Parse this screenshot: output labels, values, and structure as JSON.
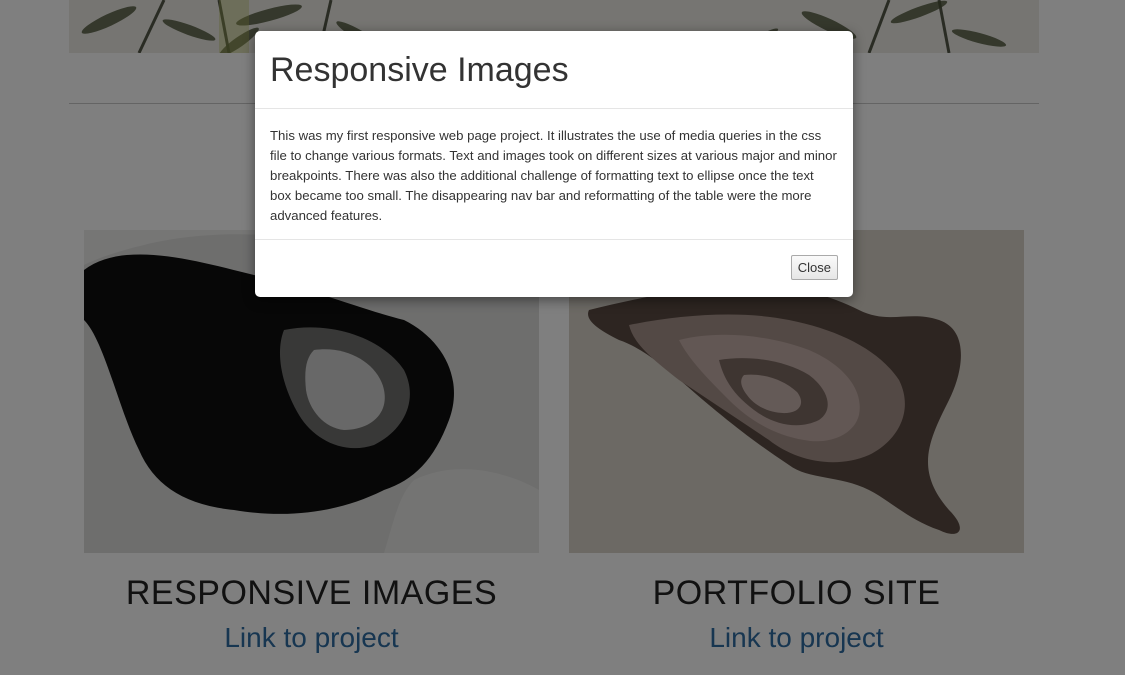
{
  "modal": {
    "title": "Responsive Images",
    "body": "This was my first responsive web page project. It illustrates the use of media queries in the css file to change various formats. Text and images took on different sizes at various major and minor breakpoints. There was also the additional challenge of formatting text to ellipse once the text box became too small. The disappearing nav bar and reformatting of the table were the more advanced features.",
    "close_label": "Close"
  },
  "projects": [
    {
      "title": "RESPONSIVE IMAGES",
      "link_label": "Link to project"
    },
    {
      "title": "PORTFOLIO SITE",
      "link_label": "Link to project"
    }
  ],
  "colors": {
    "link": "#2f6da3",
    "overlay": "rgba(0,0,0,0.5)"
  }
}
